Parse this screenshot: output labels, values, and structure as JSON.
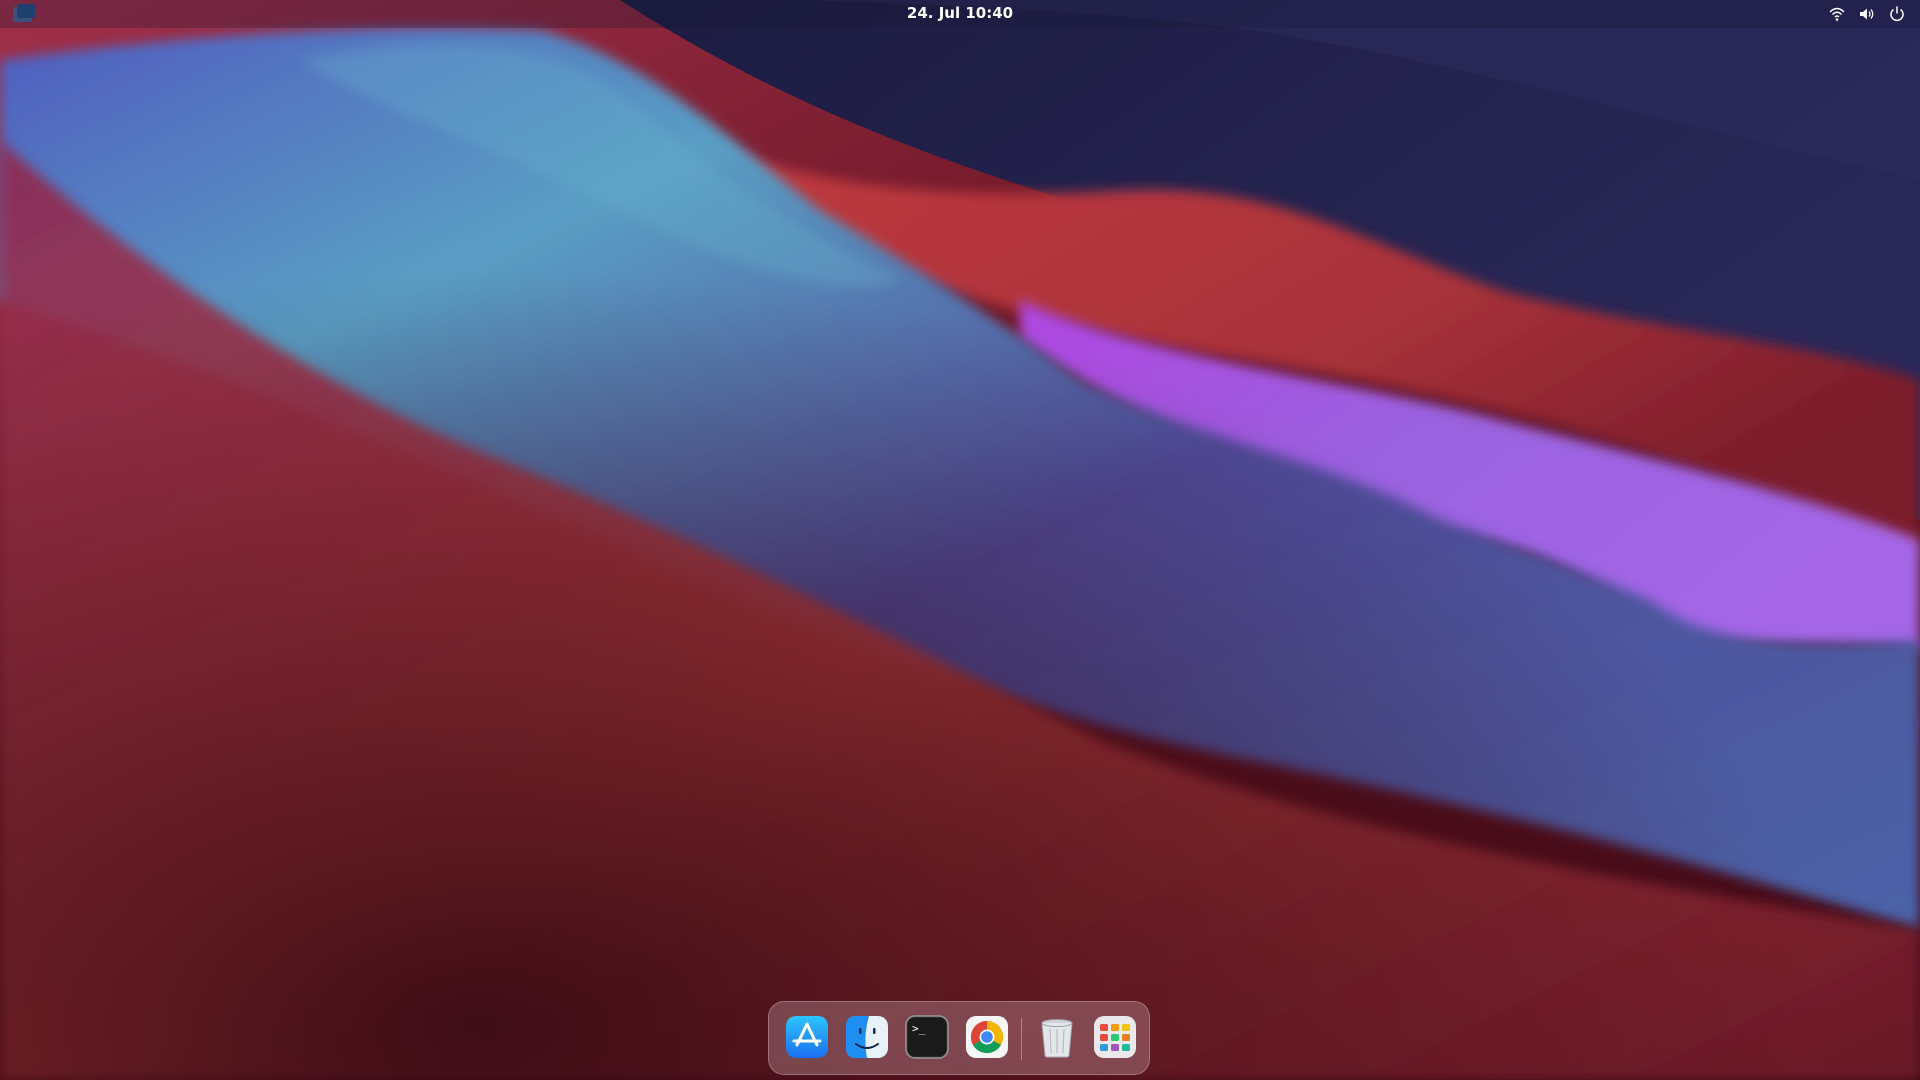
{
  "topbar": {
    "clock": "24. Jul  10:40",
    "activities_icon": "activities-icon",
    "tray": [
      {
        "name": "wifi-icon"
      },
      {
        "name": "volume-icon"
      },
      {
        "name": "power-icon"
      }
    ]
  },
  "dock": {
    "items": [
      {
        "name": "app-store-icon"
      },
      {
        "name": "finder-icon"
      },
      {
        "name": "terminal-icon",
        "glyph": ">_"
      },
      {
        "name": "chrome-icon"
      },
      {
        "name": "trash-icon"
      },
      {
        "name": "app-grid-icon"
      }
    ]
  },
  "colors": {
    "deep_red": "#4a0f1e",
    "red": "#b8383a",
    "blue": "#5a9cc4",
    "purple": "#9b5ee6",
    "navy": "#1e1c48"
  }
}
